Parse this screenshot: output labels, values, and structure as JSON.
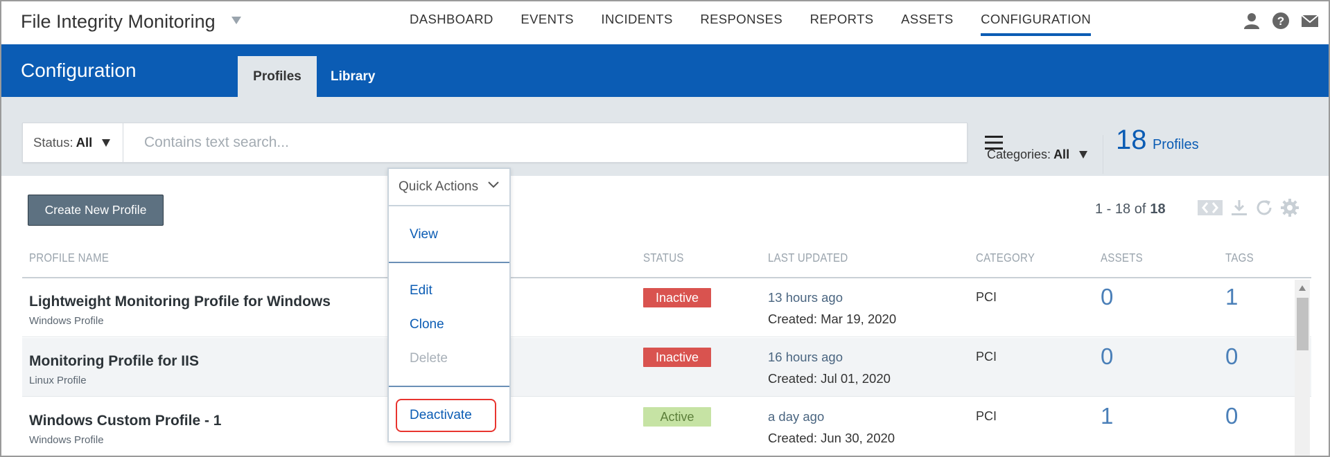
{
  "app": {
    "title": "File Integrity Monitoring"
  },
  "nav": {
    "items": [
      "DASHBOARD",
      "EVENTS",
      "INCIDENTS",
      "RESPONSES",
      "REPORTS",
      "ASSETS",
      "CONFIGURATION"
    ],
    "active": "CONFIGURATION"
  },
  "header": {
    "title": "Configuration",
    "tabs": [
      "Profiles",
      "Library"
    ],
    "active_tab": "Profiles"
  },
  "filters": {
    "categories_label": "Categories:",
    "categories_value": "All",
    "status_label": "Status:",
    "status_value": "All",
    "search_placeholder": "Contains text search..."
  },
  "summary": {
    "count": "18",
    "count_label": "Profiles"
  },
  "actions": {
    "create_label": "Create New Profile"
  },
  "pagination": {
    "range": "1 - 18 of",
    "total": "18"
  },
  "table": {
    "headers": {
      "name": "PROFILE NAME",
      "status": "STATUS",
      "updated": "LAST UPDATED",
      "category": "CATEGORY",
      "assets": "ASSETS",
      "tags": "TAGS"
    },
    "rows": [
      {
        "name": "Lightweight Monitoring Profile for Windows",
        "type": "Windows Profile",
        "status": "Inactive",
        "updated": "13 hours ago",
        "created": "Created: Mar 19, 2020",
        "category": "PCI",
        "assets": "0",
        "tags": "1"
      },
      {
        "name": "Monitoring Profile for IIS",
        "type": "Linux Profile",
        "status": "Inactive",
        "updated": "16 hours ago",
        "created": "Created: Jul 01, 2020",
        "category": "PCI",
        "assets": "0",
        "tags": "0"
      },
      {
        "name": "Windows Custom Profile - 1",
        "type": "Windows Profile",
        "status": "Active",
        "updated": "a day ago",
        "created": "Created: Jun 30, 2020",
        "category": "PCI",
        "assets": "1",
        "tags": "0"
      }
    ]
  },
  "quick_actions": {
    "label": "Quick Actions",
    "view": "View",
    "edit": "Edit",
    "clone": "Clone",
    "delete": "Delete",
    "deactivate": "Deactivate"
  },
  "colors": {
    "brand": "#0b5cb4",
    "inactive": "#d9534f",
    "active": "#c6e3a4",
    "highlight": "#e8342f"
  },
  "icons": [
    "user-icon",
    "help-icon",
    "mail-icon",
    "hamburger-menu-icon",
    "expand-columns-icon",
    "download-icon",
    "refresh-icon",
    "settings-gear-icon",
    "chevron-down-icon"
  ]
}
